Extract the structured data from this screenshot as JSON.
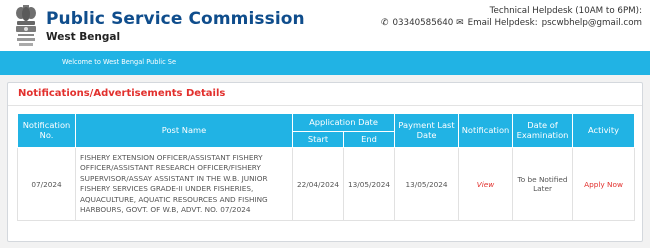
{
  "header": {
    "title": "Public Service Commission",
    "subtitle": "West Bengal",
    "helpdesk_label": "Technical Helpdesk (10AM to 6PM):",
    "helpdesk_phone": "03340585640",
    "email_label": "Email Helpdesk:",
    "email": "pscwbhelp@gmail.com",
    "icons": {
      "phone": "phone-icon",
      "email": "envelope-icon",
      "emblem": "state-emblem"
    }
  },
  "marquee": {
    "text": "Welcome to West Bengal Public Se"
  },
  "section": {
    "title": "Notifications/Advertisements Details"
  },
  "table": {
    "headers": {
      "notification_no": "Notification No.",
      "post_name": "Post Name",
      "application_date": "Application Date",
      "start": "Start",
      "end": "End",
      "payment_last_date": "Payment Last Date",
      "notification": "Notification",
      "date_of_examination": "Date of Examination",
      "activity": "Activity"
    },
    "rows": [
      {
        "notification_no": "07/2024",
        "post_name": "FISHERY EXTENSION OFFICER/ASSISTANT FISHERY OFFICER/ASSISTANT RESEARCH OFFICER/FISHERY SUPERVISOR/ASSAY ASSISTANT IN THE W.B. JUNIOR FISHERY SERVICES GRADE-II UNDER FISHERIES, AQUACULTURE, AQUATIC RESOURCES AND FISHING HARBOURS, GOVT. OF W.B, ADVT. NO. 07/2024",
        "start": "22/04/2024",
        "end": "13/05/2024",
        "payment_last_date": "13/05/2024",
        "notification": "View",
        "date_of_examination": "To be Notified Later",
        "activity": "Apply Now"
      }
    ]
  },
  "colors": {
    "brand_blue": "#0f4d8c",
    "header_cyan": "#21b3e4",
    "accent_red": "#e2302d"
  }
}
